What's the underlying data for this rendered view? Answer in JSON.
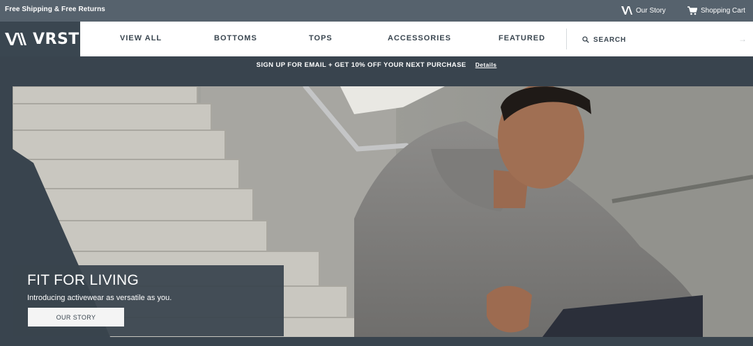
{
  "topbar": {
    "promo": "Free Shipping & Free Returns",
    "our_story": "Our Story",
    "shopping_cart": "Shopping Cart"
  },
  "nav": {
    "logo_text": "VRST",
    "links": [
      "VIEW ALL",
      "BOTTOMS",
      "TOPS",
      "ACCESSORIES",
      "FEATURED"
    ],
    "search_placeholder": "SEARCH"
  },
  "promo_banner": {
    "text": "SIGN UP FOR EMAIL + GET 10% OFF YOUR NEXT PURCHASE",
    "link": "Details"
  },
  "hero": {
    "title": "FIT FOR LIVING",
    "subtitle": "Introducing activewear as versatile as you.",
    "button": "OUR STORY"
  },
  "colors": {
    "topbar": "#56626d",
    "brand_dark": "#3a4650",
    "page_bg": "#39444e",
    "nav_bg": "#ffffff"
  },
  "icons": [
    "vrst-logo-icon",
    "shopping-cart-icon",
    "search-icon",
    "arrow-right-icon"
  ]
}
